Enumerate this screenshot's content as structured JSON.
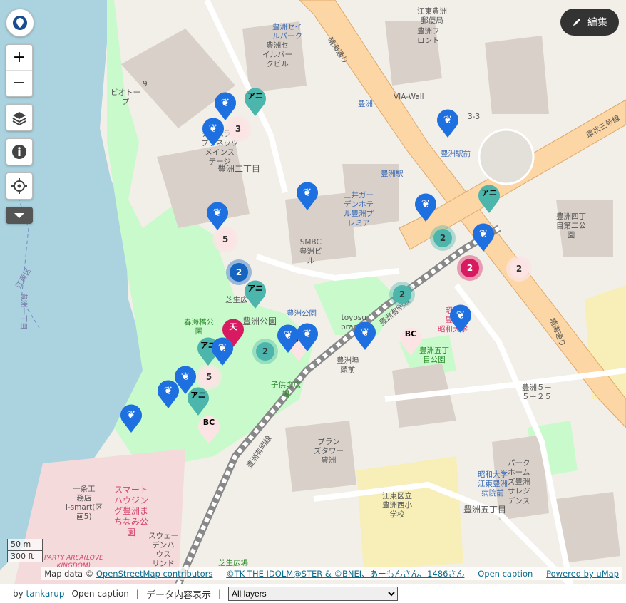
{
  "toolbar": {
    "edit_label": "編集"
  },
  "controls": {
    "zoom_in": "+",
    "zoom_out": "−"
  },
  "scale": {
    "metric": "50 m",
    "imperial": "300 ft"
  },
  "attribution": {
    "prefix": "Map data ©",
    "osm": "OpenStreetMap contributors",
    "sep1": "—",
    "credit": "©TK THE IDOLM@STER & ©BNEI、あーもんさん、1486さん",
    "sep2": "—",
    "caption": "Open caption",
    "sep3": "—",
    "powered": "Powered by uMap"
  },
  "footer": {
    "by": "by",
    "author": "tankarup",
    "open_caption": "Open caption",
    "sep1": "|",
    "data_view": "データ内容表示",
    "sep2": "|",
    "layer_select": "All layers"
  },
  "colors": {
    "teal": "#4db6ac",
    "pink": "#d81b60",
    "lightpink": "#fce4e4",
    "blue": "#1565c0",
    "pinblue": "#1e6fe0",
    "bg": "#f2efe9",
    "water": "#aad3df",
    "park": "#c8facc",
    "building": "#d9d0c9"
  },
  "map_labels": {
    "toyosu_sail": "豊洲セイ\nルパーク",
    "toyosu_sail_station": "豊洲セ\nイルバー\nクビル",
    "bio_top": "ビオトー\nプ",
    "post": "江東豊洲\n郵便局",
    "front": "豊洲フ\nロント",
    "harumi_dori": "晴海通り",
    "via_wall": "VIA-Wall",
    "toyosu_1": "豊洲",
    "toyosu_2chome": "豊洲二丁目",
    "team_lab": "チームラボ\nプラネッツ\nメインス\nテージ",
    "smbc": "SMBC\n豊洲ビ\nル",
    "mitsui": "三井ガー\nデンホテ\nル豊洲プ\nレミア",
    "toyosu_station": "豊洲駅",
    "toyosu_ekimae": "豊洲駅前",
    "toyosu_4": "豊洲四丁\n目第二公\n園",
    "ring_road": "環状三号線",
    "toyosu_park": "豊洲公園",
    "shibafu": "芝生広場",
    "harumi_bashi": "春海橋公\n園",
    "toyosu_bus": "豊洲公園",
    "toyosu_branch": "toyosu\nbranch",
    "toyosu_futo": "豊洲埠\n頭前",
    "kodomo": "子供の広\n場",
    "toyosu_5": "豊洲五丁\n目公園",
    "showa_univ": "昭和\n豊洲\n昭和大学",
    "toyosu_tower": "ブラン\nズタワー\n豊洲",
    "showa_hosp": "昭和大学\n江東豊洲\n病院前",
    "park_homes": "パーク\nホーム\nズ豊洲\nサレジ\nデンス",
    "toyosu_5_25": "豊洲５－\n５－２５",
    "nishi_school": "江東区立\n豊洲西小\n学校",
    "toyosu_5chome": "豊洲五丁目",
    "smart_housing": "スマート\nハウジン\nグ豊洲ま\nちなみ公\n園",
    "ichijo": "一条工\n務店\ni-smart(区\n画5)",
    "sweden": "スウェー\nデンハ\nウス\nリンド",
    "party_area": "PARTY AREA(LOVE\nKINGDOM)",
    "toyosu_hiroba": "芝生広場",
    "koto_ku": "江東区",
    "toyosu_1chome": "豊洲一丁目",
    "yurikamome": "豊洲有明線",
    "harumi_road2": "晴海通り",
    "number_9": "9",
    "number_33": "3-3",
    "toyosu_ariake2": "豊洲有明線"
  },
  "markers": {
    "clusters": [
      {
        "label": "3",
        "kind": "light"
      },
      {
        "label": "5",
        "kind": "light"
      },
      {
        "label": "2",
        "kind": "blue"
      },
      {
        "label": "2",
        "kind": "teal"
      },
      {
        "label": "2",
        "kind": "teal"
      },
      {
        "label": "2",
        "kind": "teal"
      },
      {
        "label": "2",
        "kind": "pink"
      },
      {
        "label": "2",
        "kind": "light"
      },
      {
        "label": "5",
        "kind": "light"
      }
    ],
    "pins": [
      {
        "label": "アニ",
        "kind": "teal"
      },
      {
        "label": "アニ",
        "kind": "teal"
      },
      {
        "label": "アニ",
        "kind": "teal"
      },
      {
        "label": "アニ",
        "kind": "teal"
      },
      {
        "label": "アニ",
        "kind": "teal"
      },
      {
        "label": "天",
        "kind": "pink"
      },
      {
        "label": "BC",
        "kind": "light"
      },
      {
        "label": "BC",
        "kind": "light"
      },
      {
        "label": "BC",
        "kind": "light"
      }
    ]
  }
}
